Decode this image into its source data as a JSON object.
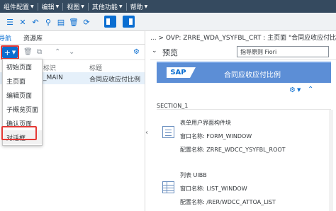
{
  "menubar": {
    "items": [
      "组件配置",
      "编辑",
      "视图",
      "其他功能",
      "帮助"
    ]
  },
  "left": {
    "tabs": [
      "导航",
      "资源库"
    ],
    "columns": [
      "标识",
      "标题"
    ],
    "selected_row": {
      "id": "_MAIN",
      "title": "合同应收应付比例"
    },
    "dropdown": [
      "初始页面",
      "主页面",
      "编辑页面",
      "子概览页面",
      "确认页面",
      "对话框"
    ]
  },
  "right": {
    "breadcrumb": "... > OVP: ZRRE_WDA_YSYFBL_CRT : 主页面 \"合同应收应付比例\"",
    "preview_title": "预览",
    "guideline_value": "指导原则 Fiori",
    "sap_logo": "SAP",
    "app_title": "合同应收应付比例",
    "section": "SECTION_1",
    "blocks": [
      {
        "type": "表单用户界面构件块",
        "window_label": "窗口名称: FORM_WINDOW",
        "config_label": "配置名称: ZRRE_WDCC_YSYFBL_ROOT"
      },
      {
        "type": "列表 UIBB",
        "window_label": "窗口名称: LIST_WINDOW",
        "config_label": "配置名称: /RER/WDCC_ATTOA_LIST"
      }
    ]
  },
  "icons": {
    "add": "plus-icon",
    "settings": "gear-icon",
    "delete": "trash-icon",
    "copy": "copy-icon"
  },
  "colors": {
    "shell": "#354a5f",
    "accent": "#0a6ed1",
    "app_header": "#5c8ed6",
    "highlight": "#e53935"
  }
}
